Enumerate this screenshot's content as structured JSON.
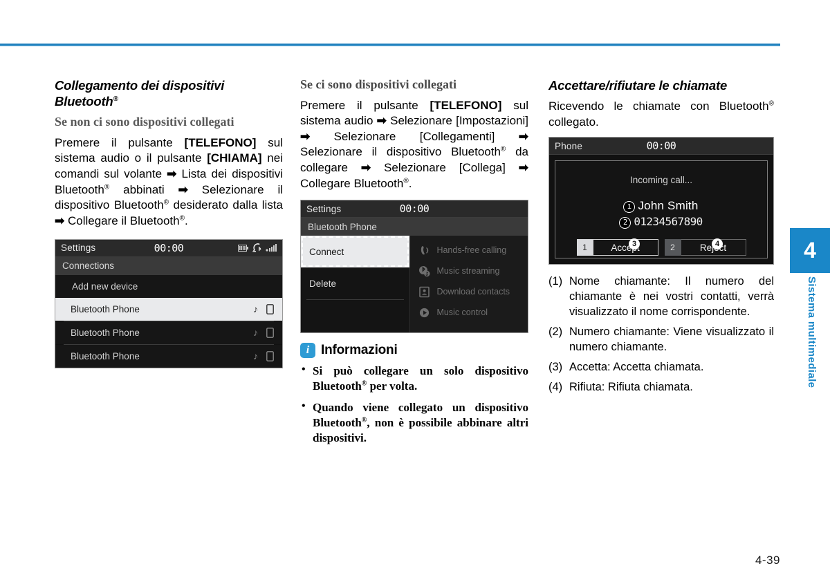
{
  "page": {
    "number": "4-39",
    "chapter_number": "4",
    "chapter_label": "Sistema multimediale",
    "accent_color": "#1a87c8"
  },
  "col1": {
    "heading": "Collegamento dei dispositivi Bluetooth®",
    "subheading": "Se non ci sono dispositivi collegati",
    "body": "Premere il pulsante [TELEFONO] sul sistema audio o il pulsante [CHIAMA] nei comandi sul volante ➡ Lista dei dispositivi Bluetooth® abbinati ➡ Selezionare il dispositivo Bluetooth® desiderato dalla lista ➡ Collegare il Bluetooth®.",
    "screen": {
      "title": "Settings",
      "clock": "00:00",
      "subtitle": "Connections",
      "add_new": "Add new device",
      "rows": [
        {
          "label": "Bluetooth Phone",
          "selected": true
        },
        {
          "label": "Bluetooth Phone",
          "selected": false
        },
        {
          "label": "Bluetooth Phone",
          "selected": false
        }
      ],
      "status_icons": [
        "battery-icon",
        "bluetooth-phone-icon",
        "signal-icon"
      ],
      "row_icons": [
        "music-note-icon",
        "device-icon"
      ]
    }
  },
  "col2": {
    "subheading": "Se ci sono dispositivi collegati",
    "body": "Premere il pulsante [TELEFONO] sul sistema audio ➡ Selezionare [Impostazioni] ➡ Selezionare [Collegamenti] ➡ Selezionare il dispositivo Bluetooth® da collegare ➡ Selezionare [Collega] ➡ Collegare Bluetooth®.",
    "screen": {
      "title": "Settings",
      "clock": "00:00",
      "subtitle": "Bluetooth Phone",
      "menu": [
        {
          "label": "Connect",
          "focused": true
        },
        {
          "label": "Delete",
          "focused": false
        }
      ],
      "features": [
        {
          "label": "Hands-free calling",
          "icon": "handset-icon"
        },
        {
          "label": "Music streaming",
          "icon": "bluetooth-music-icon"
        },
        {
          "label": "Download contacts",
          "icon": "contact-card-icon"
        },
        {
          "label": "Music control",
          "icon": "play-icon"
        }
      ]
    },
    "info": {
      "title": "Informazioni",
      "icon": "info-icon",
      "items": [
        "Si può collegare un solo dispositivo Bluetooth® per volta.",
        "Quando viene collegato un dispositivo Bluetooth®, non è possibile abbinare altri dispositivi."
      ]
    }
  },
  "col3": {
    "heading": "Accettare/rifiutare le chiamate",
    "body": "Ricevendo le chiamate con Bluetooth® collegato.",
    "screen": {
      "title": "Phone",
      "clock": "00:00",
      "incoming": "Incoming call...",
      "caller_name": "John Smith",
      "caller_number": "01234567890",
      "marker_name": "1",
      "marker_number": "2",
      "marker_accept": "3",
      "marker_reject": "4",
      "accept_key": "1",
      "accept_label": "Accept",
      "reject_key": "2",
      "reject_label": "Reject"
    },
    "legend": [
      {
        "n": "(1)",
        "text": "Nome chiamante: Il numero del chiamante è nei vostri contatti, verrà visualizzato il nome corrispondente."
      },
      {
        "n": "(2)",
        "text": "Numero chiamante: Viene visualizzato il numero chiamante."
      },
      {
        "n": "(3)",
        "text": "Accetta: Accetta chiamata."
      },
      {
        "n": "(4)",
        "text": "Rifiuta: Rifiuta chiamata."
      }
    ]
  }
}
